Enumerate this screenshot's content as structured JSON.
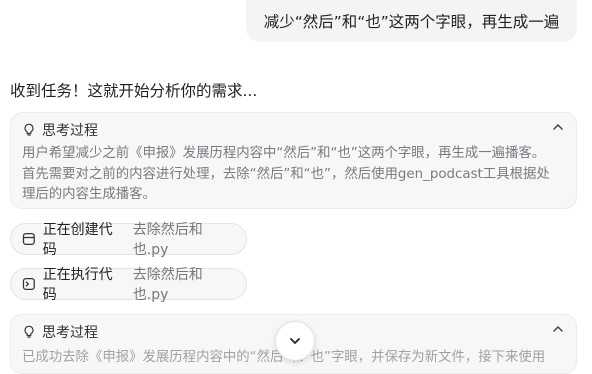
{
  "user_message": "减少“然后”和“也”这两个字眼，再生成一遍",
  "status_text": "收到任务！这就开始分析你的需求...",
  "thinking_1": {
    "title": "思考过程",
    "lines": [
      "用户希望减少之前《申报》发展历程内容中“然后”和“也”这两个字眼，再生成一遍播客。",
      "首先需要对之前的内容进行处理，去除“然后”和“也”，然后使用gen_podcast工具根据处",
      "理后的内容生成播客。"
    ]
  },
  "tool_calls": [
    {
      "action": "正在创建代码",
      "file": "去除然后和也.py",
      "icon": "file-code-icon"
    },
    {
      "action": "正在执行代码",
      "file": "去除然后和也.py",
      "icon": "terminal-icon"
    }
  ],
  "thinking_2": {
    "title": "思考过程",
    "line": "已成功去除《申报》发展历程内容中的“然后”和“也”字眼，并保存为新文件，接下来使用"
  },
  "icons": {
    "thinking": "lightbulb-icon",
    "collapse": "chevron-up-icon",
    "scroll": "chevron-down-icon"
  }
}
